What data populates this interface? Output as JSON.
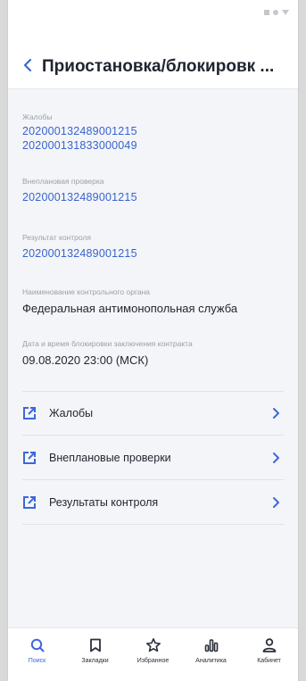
{
  "header": {
    "title": "Приостановка/блокировк ..."
  },
  "fields": {
    "complaints": {
      "label": "Жалобы",
      "links": [
        "202000132489001215",
        "202000131833000049"
      ]
    },
    "unscheduled_check": {
      "label": "Внеплановая проверка",
      "links": [
        "202000132489001215"
      ]
    },
    "control_result": {
      "label": "Результат контроля",
      "links": [
        "202000132489001215"
      ]
    },
    "control_body": {
      "label": "Наименование контрольного органа",
      "value": "Федеральная антимонопольная служба"
    },
    "block_datetime": {
      "label": "Дата и время блокировки заключения контракта",
      "value": "09.08.2020 23:00 (МСК)"
    }
  },
  "nav_rows": [
    {
      "label": "Жалобы"
    },
    {
      "label": "Внеплановые проверки"
    },
    {
      "label": "Результаты контроля"
    }
  ],
  "tabbar": [
    {
      "label": "Поиск",
      "icon": "search-icon",
      "active": true
    },
    {
      "label": "Закладки",
      "icon": "bookmark-icon",
      "active": false
    },
    {
      "label": "Избранное",
      "icon": "star-icon",
      "active": false
    },
    {
      "label": "Аналитика",
      "icon": "chart-icon",
      "active": false
    },
    {
      "label": "Кабинет",
      "icon": "user-icon",
      "active": false
    }
  ],
  "colors": {
    "accent": "#3d68d8",
    "link": "#3763cf",
    "background": "#f4f5f8"
  }
}
